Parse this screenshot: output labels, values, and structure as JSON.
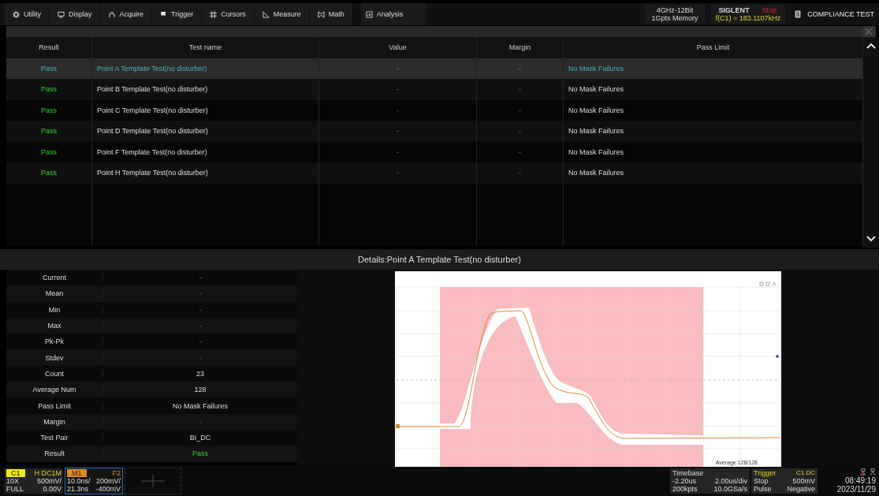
{
  "menu": [
    {
      "label": "Utility"
    },
    {
      "label": "Display"
    },
    {
      "label": "Acquire"
    },
    {
      "label": "Trigger"
    },
    {
      "label": "Cursors"
    },
    {
      "label": "Measure"
    },
    {
      "label": "Math"
    },
    {
      "label": "Analysis"
    }
  ],
  "spec": [
    "4GHz-12Bit",
    "1Gpts Memory"
  ],
  "brand": "SIGLENT",
  "run_state": "Stop",
  "frequency": "f(C1) = 183.1107kHz",
  "app_title": "COMPLIANCE TEST",
  "table": {
    "columns": [
      "Result",
      "Test name",
      "Value",
      "Margin",
      "Pass Limit"
    ],
    "rows": [
      {
        "result": "Pass",
        "name": "Point A Template Test(no disturber)",
        "value": "-",
        "margin": "-",
        "limit": "No Mask Failures",
        "selected": true
      },
      {
        "result": "Pass",
        "name": "Point B Template Test(no disturber)",
        "value": "-",
        "margin": "-",
        "limit": "No Mask Failures",
        "selected": false
      },
      {
        "result": "Pass",
        "name": "Point C Template Test(no disturber)",
        "value": "-",
        "margin": "-",
        "limit": "No Mask Failures",
        "selected": false
      },
      {
        "result": "Pass",
        "name": "Point D Template Test(no disturber)",
        "value": "-",
        "margin": "-",
        "limit": "No Mask Failures",
        "selected": false
      },
      {
        "result": "Pass",
        "name": "Point F Template Test(no disturber)",
        "value": "-",
        "margin": "-",
        "limit": "No Mask Failures",
        "selected": false
      },
      {
        "result": "Pass",
        "name": "Point H Template Test(no disturber)",
        "value": "-",
        "margin": "-",
        "limit": "No Mask Failures",
        "selected": false
      }
    ]
  },
  "details": {
    "title": "Details:Point A Template Test(no disturber)",
    "rows": [
      {
        "label": "Current",
        "value": "-",
        "kind": "text"
      },
      {
        "label": "Mean",
        "value": "-",
        "kind": "text"
      },
      {
        "label": "Min",
        "value": "-",
        "kind": "text"
      },
      {
        "label": "Max",
        "value": "-",
        "kind": "text"
      },
      {
        "label": "Pk-Pk",
        "value": "-",
        "kind": "text"
      },
      {
        "label": "Stdev",
        "value": "-",
        "kind": "text"
      },
      {
        "label": "Count",
        "value": "23",
        "kind": "text"
      },
      {
        "label": "Average Num",
        "value": "128",
        "kind": "text"
      },
      {
        "label": "Pass Limit",
        "value": "No Mask Failures",
        "kind": "text"
      },
      {
        "label": "Margin",
        "value": "-",
        "kind": "text"
      },
      {
        "label": "Test Pair",
        "value": "BI_DC",
        "kind": "text"
      },
      {
        "label": "Result",
        "value": "Pass",
        "kind": "status"
      }
    ],
    "plot_note": "Average 128/128"
  },
  "channel": {
    "name": "C1",
    "flags": "H  DC1M",
    "probe": "10X",
    "scale": "500mV/",
    "bw": "FULL",
    "offset": "0.00V"
  },
  "math": {
    "name": "M1",
    "func": "F2",
    "hscale": "10.0ns/",
    "vscale": "200mV/",
    "hpos": "21.3ns",
    "vpos": "-400mV"
  },
  "timebase": {
    "title": "Timebase",
    "delay": "-2.20us",
    "scale": "2.00us/div",
    "points": "200kpts",
    "rate": "10.0GSa/s"
  },
  "trigger": {
    "title": "Trigger",
    "source": "C1 DC",
    "state": "Stop",
    "level": "500mV",
    "type": "Pulse",
    "slope": "Negative"
  },
  "clock": {
    "time": "08:49:19",
    "date": "2023/11/29"
  }
}
